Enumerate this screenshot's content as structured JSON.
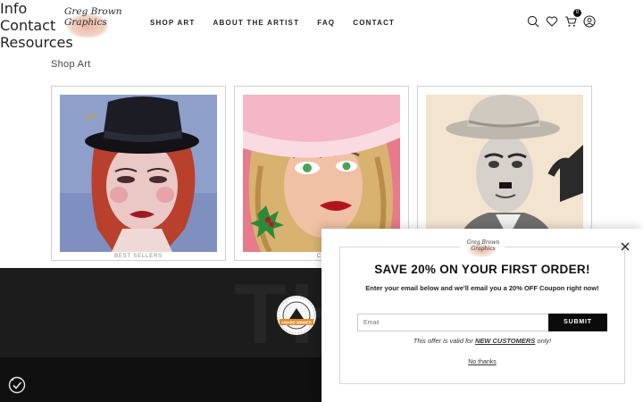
{
  "header": {
    "logo_text": "Greg Brown Graphics",
    "nav": [
      "SHOP ART",
      "ABOUT THE ARTIST",
      "FAQ",
      "CONTACT"
    ],
    "icons": [
      "search-icon",
      "heart-icon",
      "cart-icon",
      "account-icon"
    ],
    "cart_count": "0"
  },
  "main": {
    "title": "Shop Art",
    "cards": [
      {
        "caption": "BEST SELLERS"
      },
      {
        "caption": "CO"
      }
    ]
  },
  "band": {
    "ghost_text": "TH",
    "seal_text": "AWARD WINNER"
  },
  "footer": {
    "columns": [
      "Info",
      "Contact",
      "Resources"
    ]
  },
  "popup": {
    "logo_text": "Greg Brown Graphics",
    "title": "SAVE 20% ON YOUR FIRST ORDER!",
    "subtitle": "Enter your email below and we'll email you a 20% OFF Coupon right now!",
    "email_placeholder": "Email",
    "submit_label": "SUBMIT",
    "terms_prefix": "This offer is valid for ",
    "terms_highlight": "NEW CUSTOMERS",
    "terms_suffix": " only!",
    "no_thanks": "No thanks"
  },
  "colors": {
    "accent": "#0b0b0b",
    "band": "#1c1c1c",
    "footer": "#0f0f0f",
    "logo_blush": "#e8b9a3"
  }
}
